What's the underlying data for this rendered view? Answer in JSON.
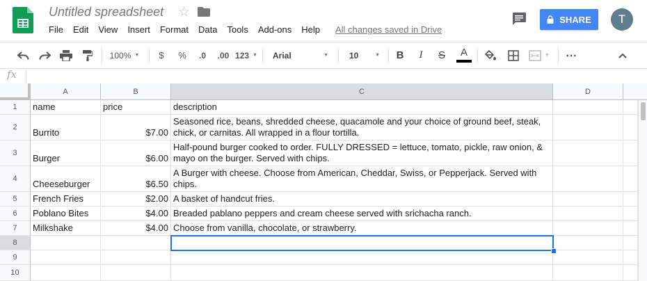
{
  "app": {
    "title": "Untitled spreadsheet",
    "saved_status": "All changes saved in Drive",
    "share_label": "SHARE",
    "avatar_initial": "T"
  },
  "menu": [
    "File",
    "Edit",
    "View",
    "Insert",
    "Format",
    "Data",
    "Tools",
    "Add-ons",
    "Help"
  ],
  "toolbar": {
    "zoom": "100%",
    "currency": "$",
    "percent": "%",
    "decrease_decimal": ".0",
    "increase_decimal": ".00",
    "more_formats": "123",
    "font": "Arial",
    "font_size": "10",
    "bold": "B",
    "italic": "I",
    "strike": "S",
    "text_color": "A",
    "more": "⋯"
  },
  "formula_bar": {
    "label": "fx",
    "value": ""
  },
  "columns": [
    "A",
    "B",
    "C",
    "D"
  ],
  "rows": [
    {
      "num": "1",
      "a": "name",
      "b": "price",
      "c": "description"
    },
    {
      "num": "2",
      "a": "Burrito",
      "b": "$7.00",
      "c": "Seasoned rice, beans, shredded cheese, quacamole and your choice of ground beef, steak, chick, or carnitas.  All wrapped in a flour tortilla."
    },
    {
      "num": "3",
      "a": "Burger",
      "b": "$6.00",
      "c": "Half-pound burger cooked to order. FULLY DRESSED = lettuce, tomato, pickle, raw onion, & mayo on the burger.  Served with chips."
    },
    {
      "num": "4",
      "a": "Cheeseburger",
      "b": "$6.50",
      "c": "A Burger with cheese.  Choose from American, Cheddar, Swiss, or Pepperjack.  Served with chips."
    },
    {
      "num": "5",
      "a": "French Fries",
      "b": "$2.00",
      "c": "A basket of handcut fries."
    },
    {
      "num": "6",
      "a": "Poblano Bites",
      "b": "$4.00",
      "c": "Breaded pablano peppers and cream cheese served with srichacha ranch."
    },
    {
      "num": "7",
      "a": "Milkshake",
      "b": "$4.00",
      "c": "Choose from vanilla, chocolate, or strawberry."
    },
    {
      "num": "8",
      "a": "",
      "b": "",
      "c": ""
    },
    {
      "num": "9",
      "a": "",
      "b": "",
      "c": ""
    },
    {
      "num": "10",
      "a": "",
      "b": "",
      "c": ""
    }
  ],
  "selected_cell": "C8",
  "colors": {
    "accent": "#4285f4",
    "selection": "#1a73e8",
    "sheets_green": "#0f9d58"
  }
}
